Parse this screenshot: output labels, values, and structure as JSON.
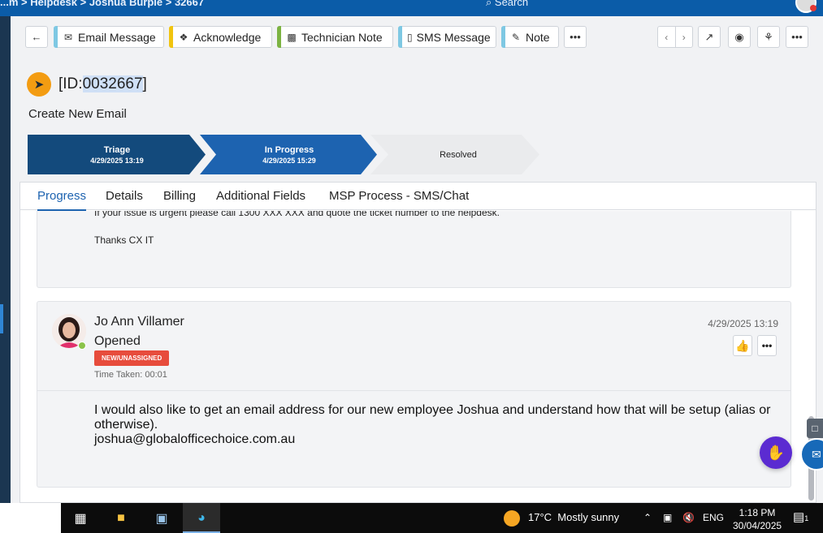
{
  "topbar": {
    "breadcrumb": "...m > Helpdesk > Joshua Burpie > 32667",
    "search_placeholder": "Search"
  },
  "toolbar": {
    "buttons": [
      {
        "label": "Email Message",
        "color": "#7ec8e3",
        "icon": "envelope-icon"
      },
      {
        "label": "Acknowledge",
        "color": "#f1c40f",
        "icon": "tag-icon"
      },
      {
        "label": "Technician Note",
        "color": "#7cb342",
        "icon": "note-icon"
      },
      {
        "label": "SMS Message",
        "color": "#7ec8e3",
        "icon": "phone-icon"
      },
      {
        "label": "Note",
        "color": "#7ec8e3",
        "icon": "edit-icon"
      }
    ],
    "more": "•••"
  },
  "ticket": {
    "id_prefix": "[ID:",
    "id_number": "0032667",
    "id_suffix": "]",
    "subtitle": "Create New Email"
  },
  "stages": [
    {
      "name": "Triage",
      "date": "4/29/2025 13:19",
      "color": "#134a7c"
    },
    {
      "name": "In Progress",
      "date": "4/29/2025 15:29",
      "color": "#1d63b0"
    },
    {
      "name": "Resolved",
      "date": "",
      "color": "#eaebed"
    }
  ],
  "tabs": [
    {
      "label": "Progress",
      "active": true
    },
    {
      "label": "Details",
      "active": false
    },
    {
      "label": "Billing",
      "active": false
    },
    {
      "label": "Additional Fields",
      "active": false
    },
    {
      "label": "MSP Process - SMS/Chat",
      "active": false
    }
  ],
  "previous_entry": {
    "cut_line": "If your issue is urgent please call 1300 XXX XXX and quote the ticket number to the helpdesk.",
    "signoff": "Thanks CX IT"
  },
  "entry": {
    "author": "Jo Ann Villamer",
    "action": "Opened",
    "status_badge": "NEW/UNASSIGNED",
    "time_taken": "Time Taken: 00:01",
    "timestamp": "4/29/2025 13:19",
    "body_line1": "I would also like to get an email address for our new employee Joshua and understand how that will be setup (alias or otherwise).",
    "body_line2": "joshua@globalofficechoice.com.au"
  },
  "taskbar": {
    "temperature": "17°C",
    "weather": "Mostly sunny",
    "language": "ENG",
    "time": "1:18 PM",
    "date": "30/04/2025",
    "notification_count": "1"
  }
}
